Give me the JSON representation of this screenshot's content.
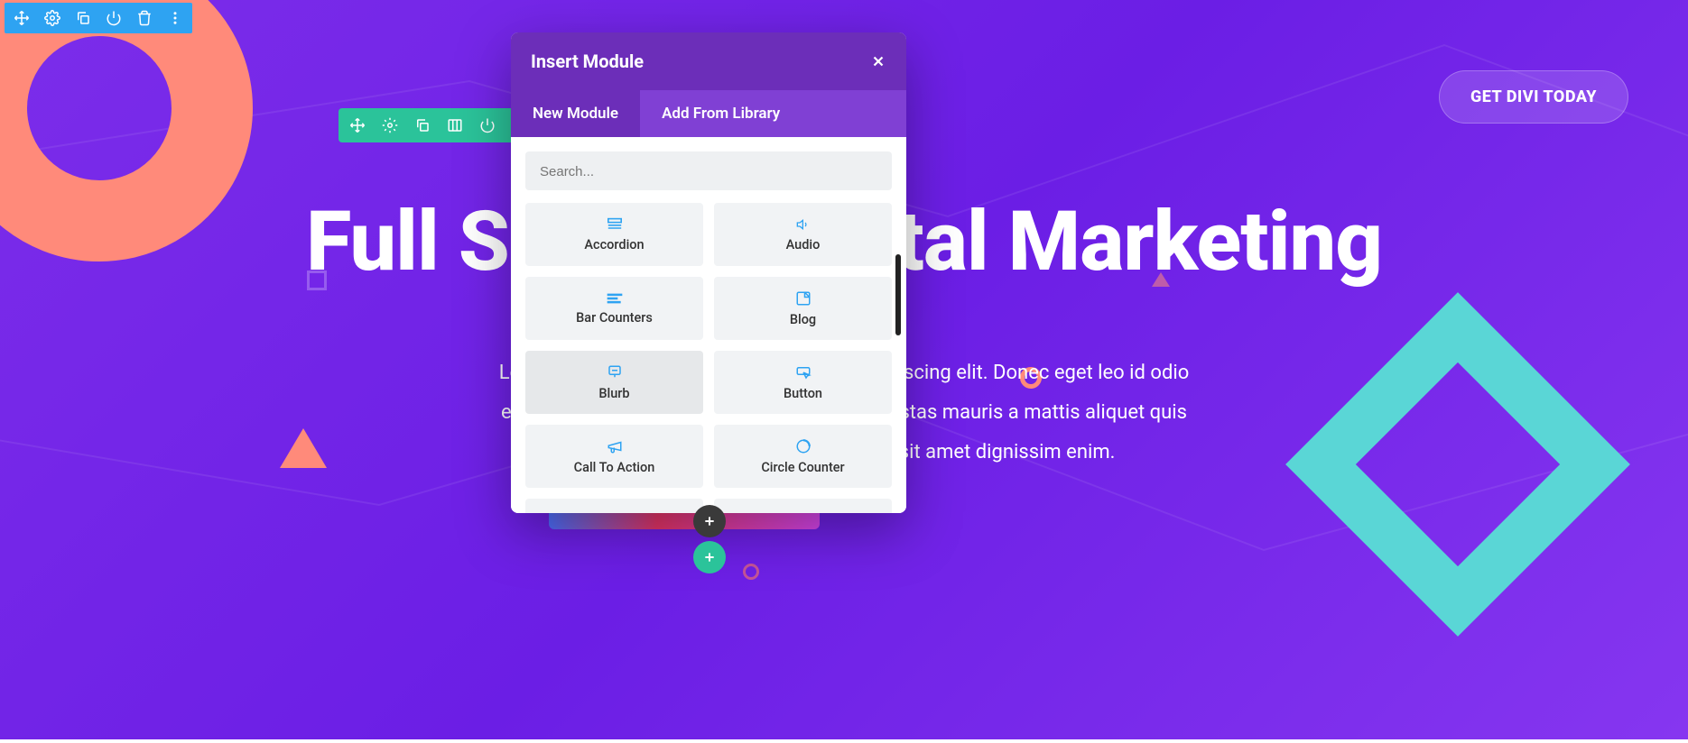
{
  "cta": {
    "label": "GET DIVI TODAY"
  },
  "hero": {
    "title": "Full Service Digital Marketing",
    "body_line1": "Lorem ipsum dolor sit amet, consectetur adipiscing elit. Donec eget leo id odio",
    "body_line2": "elementum facilisis ut cursus tellus. Duis egestas mauris a mattis aliquet quis",
    "body_line3": "volutpat metus. Aliquam sagittis nisl sit amet dignissim enim."
  },
  "modal": {
    "title": "Insert Module",
    "tabs": {
      "new": "New Module",
      "library": "Add From Library"
    },
    "search_placeholder": "Search...",
    "modules": [
      {
        "label": "Accordion",
        "icon": "accordion-icon"
      },
      {
        "label": "Audio",
        "icon": "audio-icon"
      },
      {
        "label": "Bar Counters",
        "icon": "bars-icon"
      },
      {
        "label": "Blog",
        "icon": "blog-icon"
      },
      {
        "label": "Blurb",
        "icon": "blurb-icon"
      },
      {
        "label": "Button",
        "icon": "button-icon"
      },
      {
        "label": "Call To Action",
        "icon": "cta-icon"
      },
      {
        "label": "Circle Counter",
        "icon": "circle-counter-icon"
      }
    ],
    "partial_modules": [
      {
        "icon": "code-icon"
      },
      {
        "icon": "comments-icon"
      }
    ]
  },
  "colors": {
    "bg_primary": "#7c2dea",
    "accent_blue": "#2ea3f2",
    "accent_green": "#2bc39a",
    "accent_coral": "#ff8a7a",
    "accent_teal": "#5ad6d6",
    "modal_header": "#6c2eb9",
    "modal_tabs": "#8040d4"
  }
}
